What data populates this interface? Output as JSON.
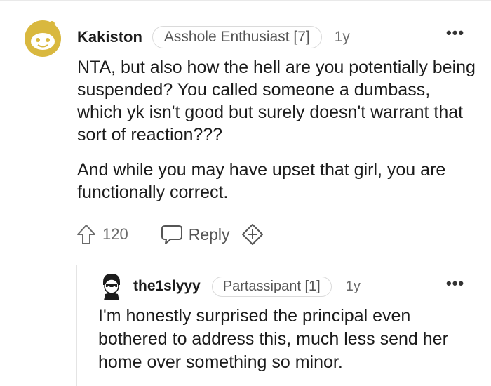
{
  "main_comment": {
    "username": "Kakiston",
    "flair": "Asshole Enthusiast [7]",
    "age": "1y",
    "more_icon": "more-dots-icon",
    "paragraphs": [
      "NTA, but also how the hell are you potentially being suspended? You called someone a dumbass, which yk isn't good but surely doesn't warrant that sort of reaction???",
      "And while you may have upset that girl, you are functionally correct."
    ],
    "vote_count": "120",
    "reply_label": "Reply",
    "upvote_icon": "upvote-arrow-icon",
    "reply_icon": "speech-bubble-icon",
    "award_icon": "add-award-icon"
  },
  "reply_comment": {
    "username": "the1slyyy",
    "flair": "Partassipant [1]",
    "age": "1y",
    "more_icon": "more-dots-icon",
    "paragraphs": [
      "I'm honestly surprised the principal even bothered to address this, much less send her home over something so minor."
    ]
  },
  "colors": {
    "text": "#1c1c1c",
    "muted": "#6b6b6b",
    "flair_border": "#dadada",
    "avatar_yellow": "#d9b83f",
    "thread_line": "#e4e4e4"
  }
}
